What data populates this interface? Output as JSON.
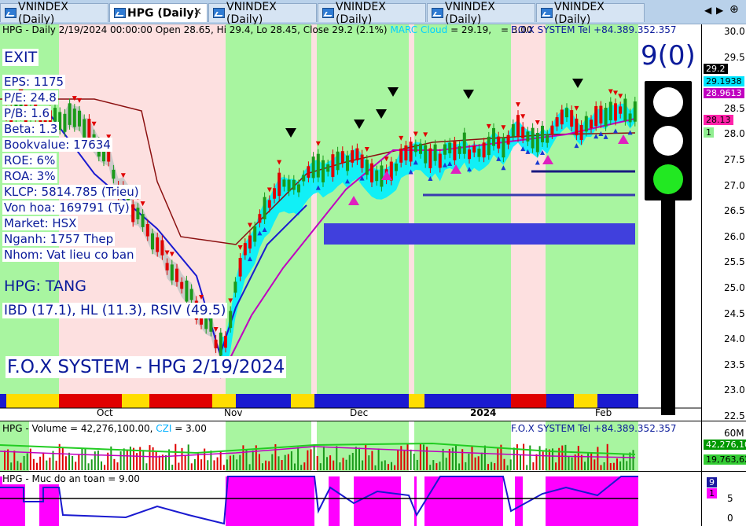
{
  "tabs": [
    {
      "label": "VNINDEX (Daily)",
      "active": false
    },
    {
      "label": "HPG (Daily)",
      "active": true,
      "close": "✕"
    },
    {
      "label": "VNINDEX (Daily)",
      "active": false
    },
    {
      "label": "VNINDEX (Daily)",
      "active": false
    },
    {
      "label": "VNINDEX (Daily)",
      "active": false
    },
    {
      "label": "VNINDEX (Daily)",
      "active": false
    }
  ],
  "tab_nav": {
    "left": "◀",
    "right": "▶",
    "add": "⊕"
  },
  "price_pane": {
    "header_left": "HPG - Daily 2/19/2024 00:00:00 Open 28.65, Hi 29.4, Lo 28.45, Close 29.2 (2.1%)",
    "header_marc": "MARC Cloud",
    "header_marc_val": "= 29.19,",
    "header_eq": "= 3.00",
    "header_right": "F.O.X SYSTEM Tel +84.389.352.357",
    "exit_label": "EXIT",
    "stats": [
      "EPS: 1175",
      "P/E: 24.8",
      "P/B: 1.6",
      "Beta: 1.3",
      "Bookvalue: 17634",
      "ROE: 6%",
      "ROA: 3%",
      "KLCP: 5814.785 (Trieu)",
      "Von hoa: 169791 (Ty)",
      "Market: HSX",
      "Nganh: 1757 Thep",
      "Nhom: Vat lieu co ban"
    ],
    "trend": "HPG: TANG",
    "indicators": "IBD (17.1), HL (11.3), RSIV (49.5)",
    "system_title": "F.O.X SYSTEM - HPG 2/19/2024",
    "signal_count": "9(0)",
    "y_ticks": [
      "30.0",
      "29.5",
      "29.0",
      "28.5",
      "28.0",
      "27.5",
      "27.0",
      "26.5",
      "26.0",
      "25.5",
      "25.0",
      "24.5",
      "24.0",
      "23.5",
      "23.0",
      "22.5"
    ],
    "price_tags": [
      {
        "text": "29.2",
        "bg": "#000000",
        "fg": "#ffffff"
      },
      {
        "text": "29.1938",
        "bg": "#00e5ff",
        "fg": "#000000"
      },
      {
        "text": "28.9613",
        "bg": "#c000c0",
        "fg": "#ffffff"
      },
      {
        "text": "28.13",
        "bg": "#ff22aa",
        "fg": "#000000"
      },
      {
        "text": "1",
        "bg": "#90ee90",
        "fg": "#000000"
      }
    ],
    "x_labels": [
      "Oct",
      "Nov",
      "Dec",
      "2024",
      "Feb"
    ]
  },
  "volume_pane": {
    "header_left": "HPG - Volume = 42,276,100.00,",
    "header_czi": "CZI",
    "header_czi_val": "= 3.00",
    "header_right": "F.O.X SYSTEM Tel +84.389.352.357",
    "y_top": "60M",
    "tags": [
      {
        "text": "42,276,10",
        "bg": "#009900",
        "fg": "#ffffff"
      },
      {
        "text": "19,763,62",
        "bg": "#33cc33",
        "fg": "#000000"
      }
    ]
  },
  "safety_pane": {
    "header_left": "HPG - Muc do an toan = 9.00",
    "y_ticks": [
      "5",
      "0"
    ],
    "tags": [
      {
        "text": "9",
        "bg": "#1a1aa0",
        "fg": "#ffffff"
      },
      {
        "text": "1",
        "bg": "#ff00ff",
        "fg": "#000000"
      }
    ]
  },
  "colors": {
    "bull_bg": "#a8f5a0",
    "bear_bg": "#fde0e0",
    "up_candle": "#1a9a1a",
    "down_candle": "#e00000",
    "cloud": "#00f0ff",
    "trend_line": "#c000c0",
    "stop_line": "#8b1010",
    "label_text": "#0a1a9a"
  }
}
